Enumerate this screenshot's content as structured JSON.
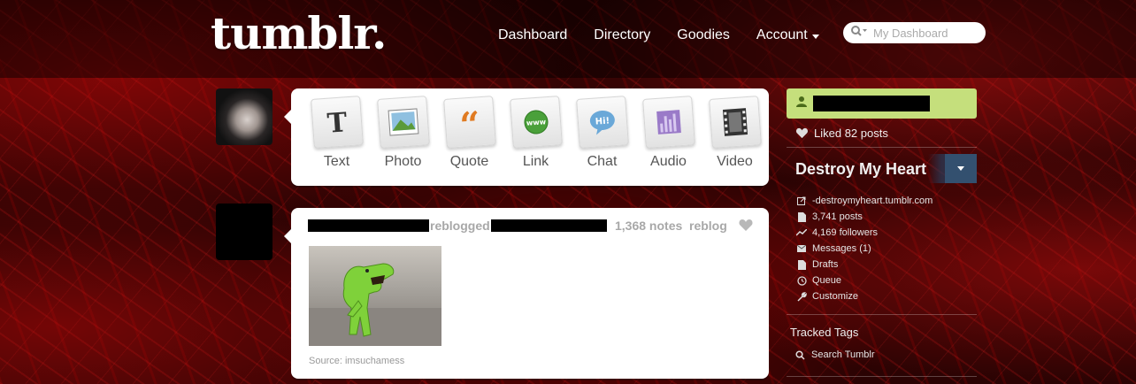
{
  "header": {
    "logo": "tumblr.",
    "nav": [
      {
        "label": "Dashboard"
      },
      {
        "label": "Directory"
      },
      {
        "label": "Goodies"
      },
      {
        "label": "Account"
      }
    ],
    "search_placeholder": "My Dashboard"
  },
  "composer": {
    "types": [
      {
        "label": "Text",
        "icon": "text-icon"
      },
      {
        "label": "Photo",
        "icon": "photo-icon"
      },
      {
        "label": "Quote",
        "icon": "quote-icon"
      },
      {
        "label": "Link",
        "icon": "link-icon"
      },
      {
        "label": "Chat",
        "icon": "chat-icon"
      },
      {
        "label": "Audio",
        "icon": "audio-icon"
      },
      {
        "label": "Video",
        "icon": "video-icon"
      }
    ]
  },
  "post": {
    "reblogged_word": "reblogged",
    "notes": "1,368 notes",
    "reblog_label": "reblog",
    "source": "Source: imsuchamess"
  },
  "sidebar": {
    "liked": "Liked 82 posts",
    "blog_title": "Destroy My Heart",
    "links": [
      {
        "label": "-destroymyheart.tumblr.com",
        "icon": "external-link-icon"
      },
      {
        "label": "3,741 posts",
        "icon": "document-icon"
      },
      {
        "label": "4,169 followers",
        "icon": "trend-icon"
      },
      {
        "label": "Messages (1)",
        "icon": "envelope-icon"
      },
      {
        "label": "Drafts",
        "icon": "document-icon"
      },
      {
        "label": "Queue",
        "icon": "clock-icon"
      },
      {
        "label": "Customize",
        "icon": "wrench-icon"
      }
    ],
    "tracked_tags": "Tracked Tags",
    "search_tumblr": "Search Tumblr"
  },
  "colors": {
    "user_bar": "#c5df7c",
    "blog_menu": "#33506f",
    "meta_text": "#a8a8a8"
  }
}
